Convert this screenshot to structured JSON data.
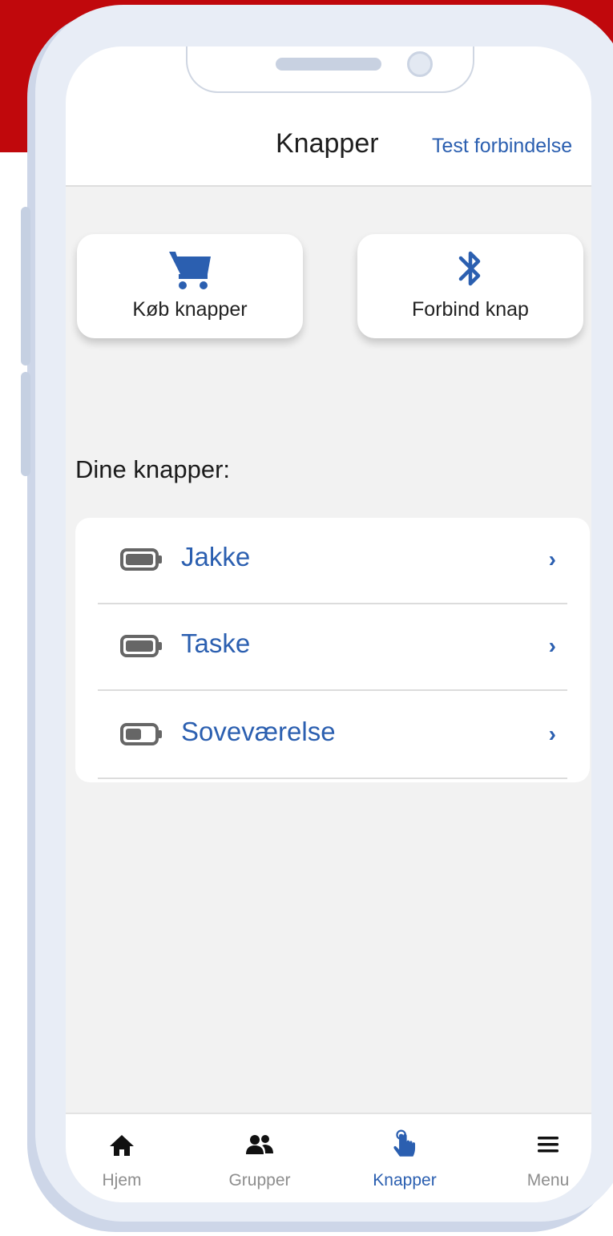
{
  "header": {
    "title": "Knapper",
    "link": "Test forbindelse"
  },
  "actions": [
    {
      "label": "Køb knapper",
      "icon": "cart-icon"
    },
    {
      "label": "Forbind knap",
      "icon": "bluetooth-icon"
    }
  ],
  "section": {
    "title": "Dine knapper:"
  },
  "buttons_list": [
    {
      "label": "Jakke",
      "battery_level": 1.0
    },
    {
      "label": "Taske",
      "battery_level": 1.0
    },
    {
      "label": "Soveværelse",
      "battery_level": 0.55
    }
  ],
  "chevron": "›",
  "tabbar": {
    "tabs": [
      {
        "label": "Hjem",
        "icon": "home-icon",
        "active": false
      },
      {
        "label": "Grupper",
        "icon": "group-icon",
        "active": false
      },
      {
        "label": "Knapper",
        "icon": "tap-hand-icon",
        "active": true
      },
      {
        "label": "Menu",
        "icon": "hamburger-icon",
        "active": false
      }
    ]
  },
  "colors": {
    "accent": "#2b5fb0",
    "brand_red": "#c0080c",
    "screen_bg": "#f2f2f2",
    "battery": "#666666"
  }
}
